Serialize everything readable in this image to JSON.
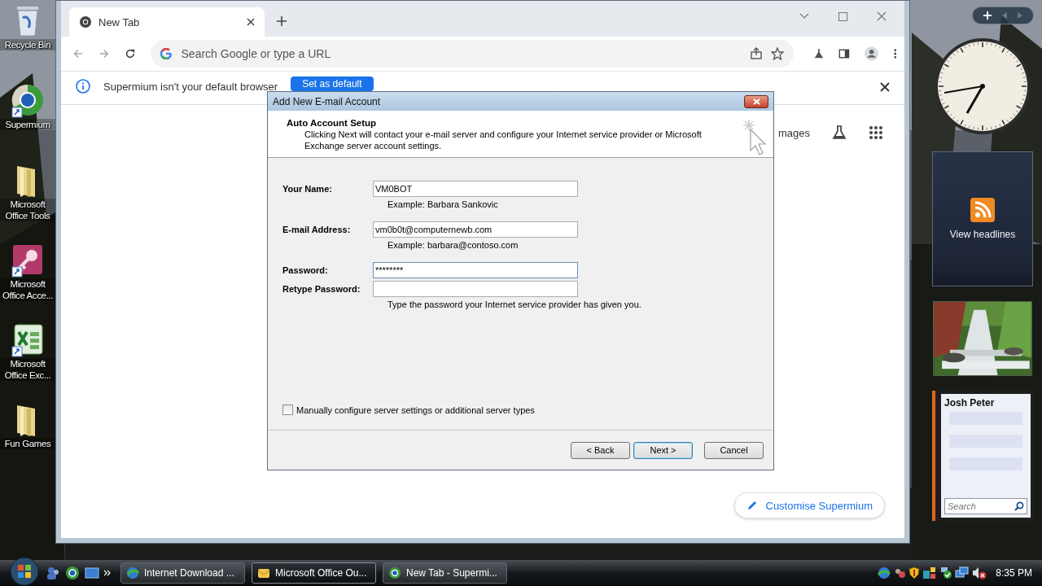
{
  "desktop_icons": [
    {
      "label": "Recycle Bin",
      "kind": "bin"
    },
    {
      "label": "Supermium",
      "kind": "browser"
    },
    {
      "label": "Microsoft Office Tools",
      "kind": "folder"
    },
    {
      "label": "Microsoft Office Acce...",
      "kind": "access"
    },
    {
      "label": "Microsoft Office Exc...",
      "kind": "excel"
    },
    {
      "label": "Fun Games",
      "kind": "folder"
    }
  ],
  "browser": {
    "tab": {
      "title": "New Tab",
      "selected": true
    },
    "address": {
      "placeholder": "Search Google or type a URL"
    },
    "infobar": {
      "message": "Supermium isn't your default browser",
      "button": "Set as default"
    },
    "page": {
      "images_link": "mages",
      "customise_button": "Customise Supermium"
    }
  },
  "dialog": {
    "title": "Add New E-mail Account",
    "heading": "Auto Account Setup",
    "description": "Clicking Next will contact your e-mail server and configure your Internet service provider or Microsoft Exchange server account settings.",
    "fields": [
      {
        "label": "Your Name:",
        "value": "VM0BOT",
        "focused": false,
        "example": "Example: Barbara Sankovic"
      },
      {
        "label": "E-mail Address:",
        "value": "vm0b0t@computernewb.com",
        "focused": false,
        "example": "Example: barbara@contoso.com"
      },
      {
        "label": "Password:",
        "value": "********",
        "focused": true
      },
      {
        "label": "Retype Password:",
        "focused": false,
        "example": "Type the password your Internet service provider has given you."
      }
    ],
    "manual_config": {
      "label": "Manually configure server settings or additional server types",
      "checked": false
    },
    "buttons": [
      {
        "label": "< Back",
        "default": false
      },
      {
        "label": "Next >",
        "default": true
      },
      {
        "label": "Cancel",
        "default": false
      }
    ]
  },
  "sidebar": {
    "feed": {
      "label": "View headlines"
    },
    "contacts": {
      "name": "Josh Peter",
      "search": {
        "placeholder": "Search"
      }
    }
  },
  "taskbar": {
    "tasks": [
      {
        "label": "Internet Download ...",
        "kind": "download",
        "selected": false
      },
      {
        "label": "Microsoft Office Ou...",
        "kind": "outlook",
        "selected": true
      },
      {
        "label": "New Tab - Supermi...",
        "kind": "browser",
        "selected": false
      }
    ],
    "clock": "8:35 PM"
  }
}
